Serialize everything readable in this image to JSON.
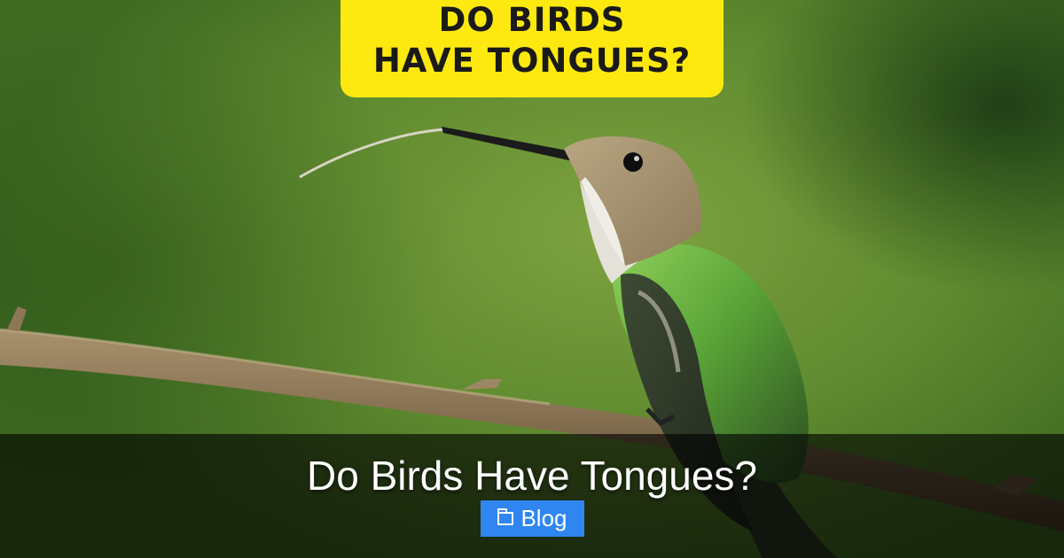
{
  "image": {
    "headline_line1": "DO BIRDS",
    "headline_line2": "HAVE TONGUES?",
    "badge_color": "#fde90f"
  },
  "post": {
    "title": "Do Birds Have Tongues?",
    "category": {
      "icon": "folder-icon",
      "label": "Blog",
      "color": "#2f86f0"
    }
  }
}
